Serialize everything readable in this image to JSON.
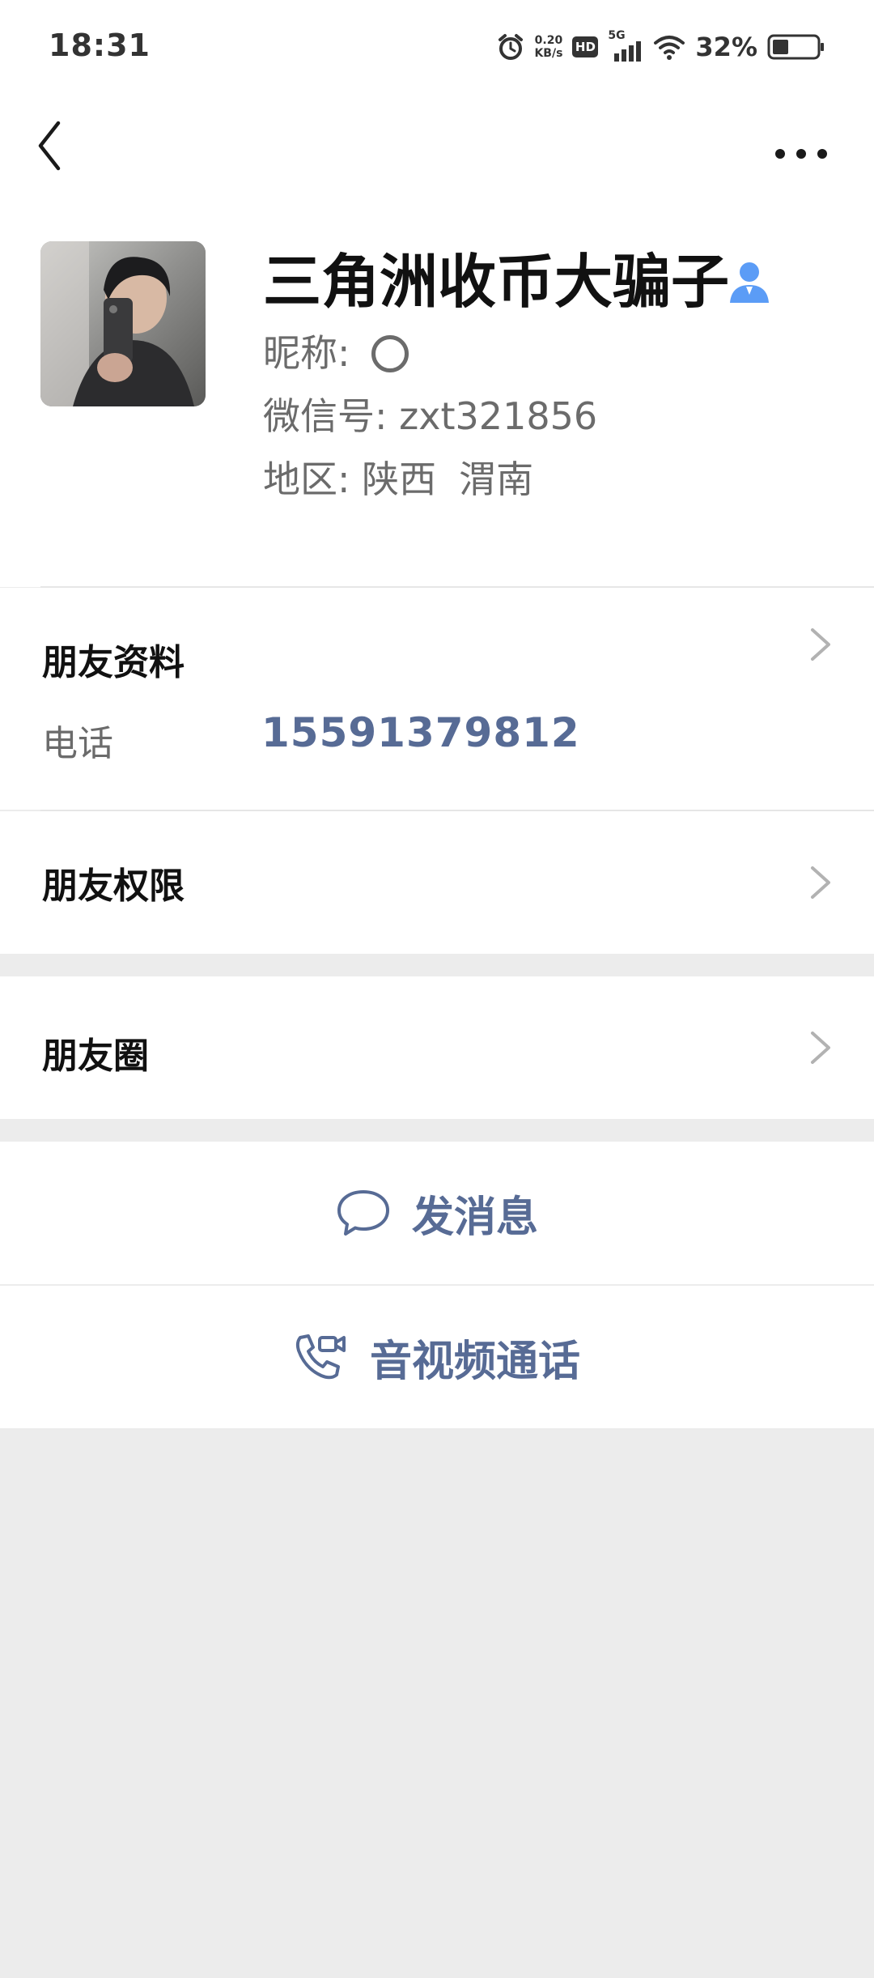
{
  "status_bar": {
    "time": "18:31",
    "net_speed_value": "0.20",
    "net_speed_unit": "KB/s",
    "hd_label": "HD",
    "network_label": "5G",
    "battery_percent": "32%"
  },
  "profile": {
    "name": "三角洲收币大骗子",
    "nickname_label": "昵称:",
    "wechat_label": "微信号:",
    "wechat_id": "zxt321856",
    "region_label": "地区:",
    "region_province": "陕西",
    "region_city": "渭南"
  },
  "friend_info": {
    "title": "朋友资料",
    "phone_label": "电话",
    "phone_value": "15591379812"
  },
  "friend_permissions": {
    "title": "朋友权限"
  },
  "moments": {
    "title": "朋友圈"
  },
  "actions": {
    "send_message": "发消息",
    "av_call": "音视频通话"
  },
  "colors": {
    "accent": "#576b95",
    "background": "#ececec",
    "contact_icon": "#5b9cf6"
  },
  "icons": {
    "back": "back-arrow-icon",
    "more": "more-dots-icon",
    "contact": "contact-person-icon",
    "chevron": "chevron-right-icon",
    "message": "chat-bubble-icon",
    "call": "video-call-icon",
    "alarm": "alarm-icon",
    "signal": "signal-icon",
    "wifi": "wifi-icon",
    "battery": "battery-icon"
  }
}
